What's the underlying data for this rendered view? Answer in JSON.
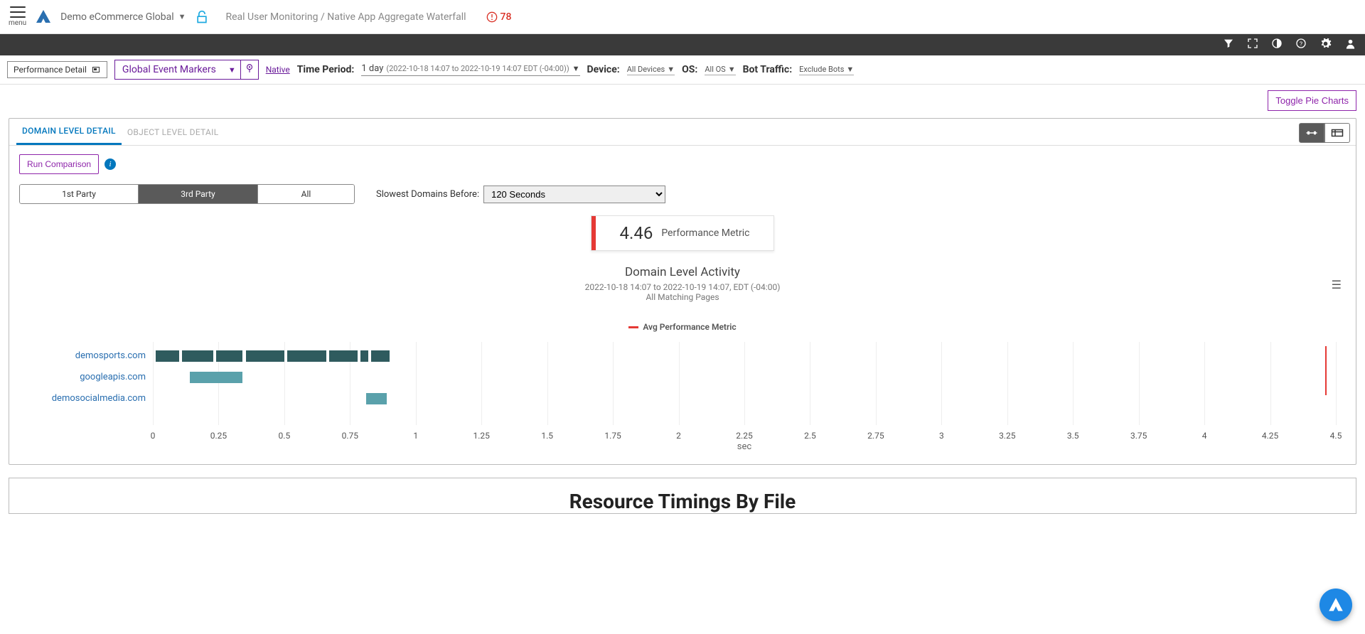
{
  "header": {
    "menu_label": "menu",
    "app_name": "Demo eCommerce Global",
    "breadcrumb": "Real User Monitoring / Native App Aggregate Waterfall",
    "alert_count": "78"
  },
  "filters": {
    "perf_detail": "Performance Detail",
    "global_markers": "Global Event Markers",
    "native": "Native",
    "time_period_label": "Time Period:",
    "time_period_main": "1 day",
    "time_period_detail": "(2022-10-18 14:07 to 2022-10-19 14:07 EDT (-04:00))",
    "device_label": "Device:",
    "device_value": "All Devices",
    "os_label": "OS:",
    "os_value": "All OS",
    "bot_label": "Bot Traffic:",
    "bot_value": "Exclude Bots"
  },
  "actions": {
    "toggle_pie": "Toggle Pie Charts",
    "run_comparison": "Run Comparison"
  },
  "tabs": {
    "domain": "DOMAIN LEVEL DETAIL",
    "object": "OBJECT LEVEL DETAIL"
  },
  "party_seg": {
    "first": "1st Party",
    "third": "3rd Party",
    "all": "All"
  },
  "slowest": {
    "label": "Slowest Domains Before:",
    "value": "120 Seconds"
  },
  "metric": {
    "value": "4.46",
    "label": "Performance Metric"
  },
  "chart": {
    "title": "Domain Level Activity",
    "sub1": "2022-10-18 14:07 to 2022-10-19 14:07, EDT (-04:00)",
    "sub2": "All Matching Pages",
    "legend": "Avg Performance Metric",
    "xaxis": "sec"
  },
  "second_panel": {
    "title": "Resource Timings By File"
  },
  "chart_data": {
    "type": "bar",
    "xlabel": "sec",
    "xlim": [
      0,
      4.5
    ],
    "x_ticks": [
      0,
      0.25,
      0.5,
      0.75,
      1,
      1.25,
      1.5,
      1.75,
      2,
      2.25,
      2.5,
      2.75,
      3,
      3.25,
      3.5,
      3.75,
      4,
      4.25,
      4.5
    ],
    "avg_performance_metric": 4.46,
    "series": [
      {
        "name": "demosports.com",
        "start": 0.01,
        "end": 0.9,
        "segments": [
          {
            "from": 0.01,
            "to": 0.1,
            "color": "#2f5b5e"
          },
          {
            "from": 0.1,
            "to": 0.11,
            "color": "#ffffff"
          },
          {
            "from": 0.11,
            "to": 0.23,
            "color": "#2f5b5e"
          },
          {
            "from": 0.23,
            "to": 0.24,
            "color": "#ffffff"
          },
          {
            "from": 0.24,
            "to": 0.34,
            "color": "#2f5b5e"
          },
          {
            "from": 0.34,
            "to": 0.355,
            "color": "#ffffff"
          },
          {
            "from": 0.355,
            "to": 0.5,
            "color": "#2f5b5e"
          },
          {
            "from": 0.5,
            "to": 0.51,
            "color": "#ffffff"
          },
          {
            "from": 0.51,
            "to": 0.66,
            "color": "#2f5b5e"
          },
          {
            "from": 0.66,
            "to": 0.67,
            "color": "#ffffff"
          },
          {
            "from": 0.67,
            "to": 0.78,
            "color": "#2f5b5e"
          },
          {
            "from": 0.78,
            "to": 0.79,
            "color": "#ffffff"
          },
          {
            "from": 0.79,
            "to": 0.82,
            "color": "#2f5b5e"
          },
          {
            "from": 0.82,
            "to": 0.83,
            "color": "#ffffff"
          },
          {
            "from": 0.83,
            "to": 0.9,
            "color": "#2f5b5e"
          }
        ]
      },
      {
        "name": "googleapis.com",
        "start": 0.14,
        "end": 0.34,
        "segments": [
          {
            "from": 0.14,
            "to": 0.34,
            "color": "#5aa1ab"
          }
        ]
      },
      {
        "name": "demosocialmedia.com",
        "start": 0.81,
        "end": 0.89,
        "segments": [
          {
            "from": 0.81,
            "to": 0.89,
            "color": "#5aa1ab"
          }
        ]
      }
    ]
  }
}
